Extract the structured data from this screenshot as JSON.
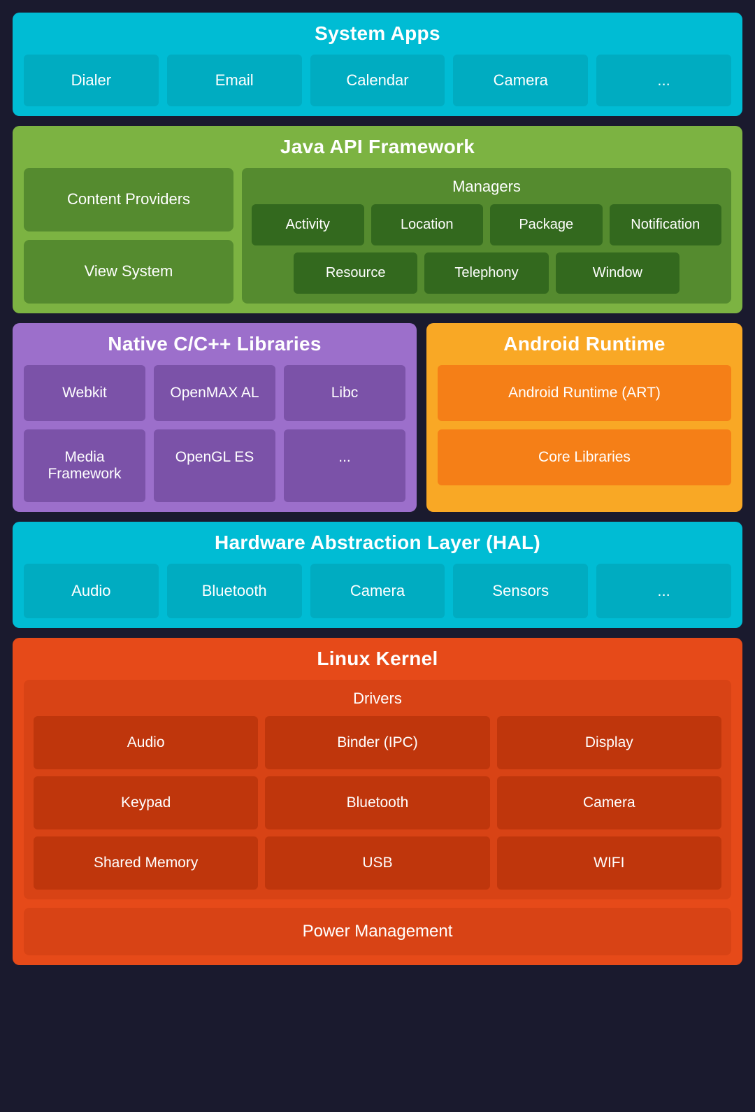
{
  "systemApps": {
    "title": "System Apps",
    "apps": [
      "Dialer",
      "Email",
      "Calendar",
      "Camera",
      "..."
    ]
  },
  "javaApi": {
    "title": "Java API Framework",
    "contentProviders": "Content Providers",
    "viewSystem": "View System",
    "managers": {
      "title": "Managers",
      "row1": [
        "Activity",
        "Location",
        "Package",
        "Notification"
      ],
      "row2": [
        "Resource",
        "Telephony",
        "Window"
      ]
    }
  },
  "nativeLibs": {
    "title": "Native C/C++ Libraries",
    "libs": [
      "Webkit",
      "OpenMAX AL",
      "Libc",
      "Media Framework",
      "OpenGL ES",
      "..."
    ]
  },
  "androidRuntime": {
    "title": "Android Runtime",
    "items": [
      "Android Runtime (ART)",
      "Core Libraries"
    ]
  },
  "hal": {
    "title": "Hardware Abstraction Layer (HAL)",
    "items": [
      "Audio",
      "Bluetooth",
      "Camera",
      "Sensors",
      "..."
    ]
  },
  "linuxKernel": {
    "title": "Linux Kernel",
    "drivers": {
      "title": "Drivers",
      "items": [
        "Audio",
        "Binder (IPC)",
        "Display",
        "Keypad",
        "Bluetooth",
        "Camera",
        "Shared Memory",
        "USB",
        "WIFI"
      ]
    },
    "powerManagement": "Power Management"
  }
}
